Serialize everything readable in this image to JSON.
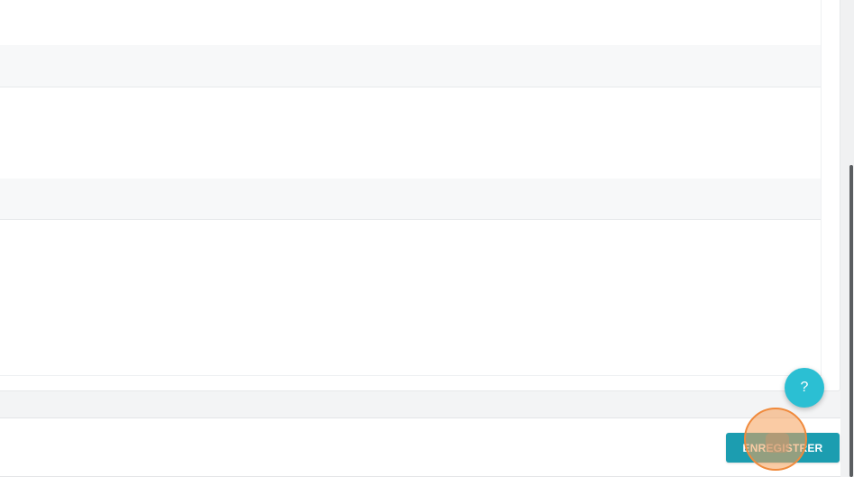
{
  "footer": {
    "save_label": "ENREGISTRER"
  },
  "help": {
    "label": "?"
  },
  "colors": {
    "primary_button": "#1c9db0",
    "help_button": "#2bbfd3",
    "click_indicator": "#f08a3c"
  },
  "icons": {
    "help": "question-mark-icon"
  }
}
